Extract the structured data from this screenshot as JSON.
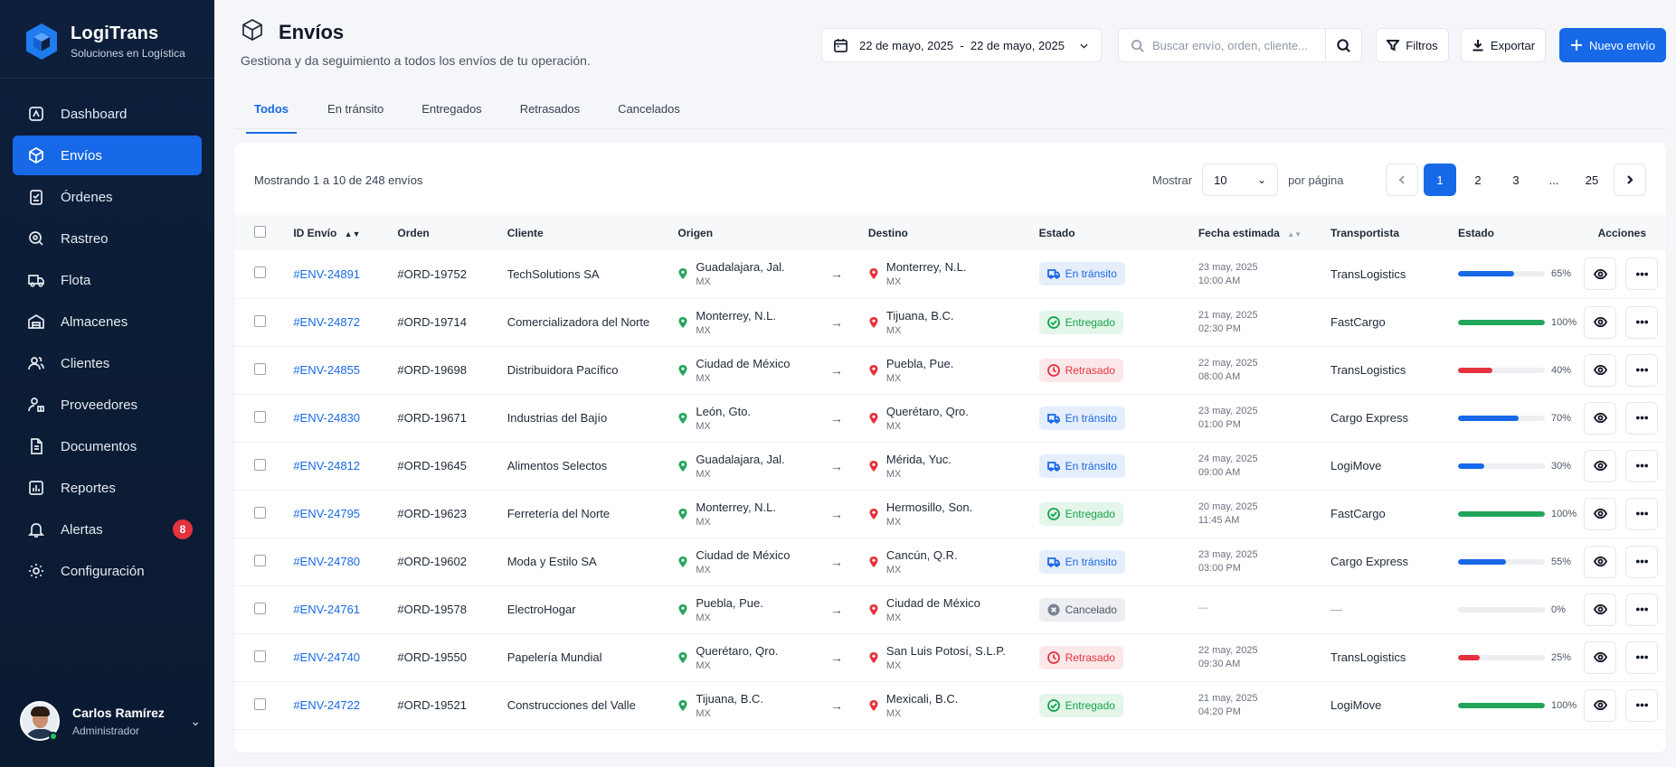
{
  "brand": {
    "name": "LogiTrans",
    "subtitle": "Soluciones en Logística"
  },
  "nav": [
    {
      "label": "Dashboard",
      "icon": "dashboard-icon",
      "active": false
    },
    {
      "label": "Envíos",
      "icon": "box-icon",
      "active": true
    },
    {
      "label": "Órdenes",
      "icon": "clipboard-icon",
      "active": false
    },
    {
      "label": "Rastreo",
      "icon": "radar-icon",
      "active": false
    },
    {
      "label": "Flota",
      "icon": "truck-icon",
      "active": false
    },
    {
      "label": "Almacenes",
      "icon": "warehouse-icon",
      "active": false
    },
    {
      "label": "Clientes",
      "icon": "users-icon",
      "active": false
    },
    {
      "label": "Proveedores",
      "icon": "supplier-icon",
      "active": false
    },
    {
      "label": "Documentos",
      "icon": "document-icon",
      "active": false
    },
    {
      "label": "Reportes",
      "icon": "report-icon",
      "active": false
    },
    {
      "label": "Alertas",
      "icon": "bell-icon",
      "active": false,
      "badge": "8"
    },
    {
      "label": "Configuración",
      "icon": "gear-icon",
      "active": false
    }
  ],
  "user": {
    "name": "Carlos Ramírez",
    "role": "Administrador"
  },
  "header": {
    "title": "Envíos",
    "subtitle": "Gestiona y da seguimiento a todos los envíos de tu operación.",
    "date_range": "22 de mayo, 2025  -  22 de mayo, 2025",
    "search_placeholder": "Buscar envío, orden, cliente...",
    "filters_label": "Filtros",
    "export_label": "Exportar",
    "new_label": "Nuevo envío"
  },
  "tabs": [
    {
      "label": "Todos",
      "active": true
    },
    {
      "label": "En tránsito",
      "active": false
    },
    {
      "label": "Entregados",
      "active": false
    },
    {
      "label": "Retrasados",
      "active": false
    },
    {
      "label": "Cancelados",
      "active": false
    }
  ],
  "table_meta": {
    "showing": "Mostrando 1 a 10 de 248 envíos",
    "show_label": "Mostrar",
    "per_page_value": "10",
    "per_page_suffix": "por página",
    "pages": [
      "1",
      "2",
      "3",
      "...",
      "25"
    ],
    "current_page": "1"
  },
  "columns": [
    "ID Envío",
    "Orden",
    "Cliente",
    "Origen",
    "Destino",
    "Estado",
    "Fecha estimada",
    "Transportista",
    "Estado",
    "Acciones"
  ],
  "colors": {
    "primary": "#1769e8",
    "transit": "#1769e8",
    "delivered": "#22a55a",
    "delayed": "#e5323e",
    "cancelled": "#6b7280"
  },
  "rows": [
    {
      "id": "#ENV-24891",
      "order": "#ORD-19752",
      "client": "TechSolutions SA",
      "origin": "Guadalajara, Jal.",
      "origin_country": "MX",
      "dest": "Monterrey, N.L.",
      "dest_country": "MX",
      "status": "En tránsito",
      "status_kind": "transit",
      "date": "23 may, 2025",
      "time": "10:00 AM",
      "carrier": "TransLogistics",
      "progress": 65,
      "progress_label": "65%"
    },
    {
      "id": "#ENV-24872",
      "order": "#ORD-19714",
      "client": "Comercializadora del Norte",
      "origin": "Monterrey, N.L.",
      "origin_country": "MX",
      "dest": "Tijuana, B.C.",
      "dest_country": "MX",
      "status": "Entregado",
      "status_kind": "delivered",
      "date": "21 may, 2025",
      "time": "02:30 PM",
      "carrier": "FastCargo",
      "progress": 100,
      "progress_label": "100%"
    },
    {
      "id": "#ENV-24855",
      "order": "#ORD-19698",
      "client": "Distribuidora Pacífico",
      "origin": "Ciudad de México",
      "origin_country": "MX",
      "dest": "Puebla, Pue.",
      "dest_country": "MX",
      "status": "Retrasado",
      "status_kind": "delayed",
      "date": "22 may, 2025",
      "time": "08:00 AM",
      "carrier": "TransLogistics",
      "progress": 40,
      "progress_label": "40%"
    },
    {
      "id": "#ENV-24830",
      "order": "#ORD-19671",
      "client": "Industrias del Bajío",
      "origin": "León, Gto.",
      "origin_country": "MX",
      "dest": "Querétaro, Qro.",
      "dest_country": "MX",
      "status": "En tránsito",
      "status_kind": "transit",
      "date": "23 may, 2025",
      "time": "01:00 PM",
      "carrier": "Cargo Express",
      "progress": 70,
      "progress_label": "70%"
    },
    {
      "id": "#ENV-24812",
      "order": "#ORD-19645",
      "client": "Alimentos Selectos",
      "origin": "Guadalajara, Jal.",
      "origin_country": "MX",
      "dest": "Mérida, Yuc.",
      "dest_country": "MX",
      "status": "En tránsito",
      "status_kind": "transit",
      "date": "24 may, 2025",
      "time": "09:00 AM",
      "carrier": "LogiMove",
      "progress": 30,
      "progress_label": "30%"
    },
    {
      "id": "#ENV-24795",
      "order": "#ORD-19623",
      "client": "Ferretería del Norte",
      "origin": "Monterrey, N.L.",
      "origin_country": "MX",
      "dest": "Hermosillo, Son.",
      "dest_country": "MX",
      "status": "Entregado",
      "status_kind": "delivered",
      "date": "20 may, 2025",
      "time": "11:45 AM",
      "carrier": "FastCargo",
      "progress": 100,
      "progress_label": "100%"
    },
    {
      "id": "#ENV-24780",
      "order": "#ORD-19602",
      "client": "Moda y Estilo SA",
      "origin": "Ciudad de México",
      "origin_country": "MX",
      "dest": "Cancún, Q.R.",
      "dest_country": "MX",
      "status": "En tránsito",
      "status_kind": "transit",
      "date": "23 may, 2025",
      "time": "03:00 PM",
      "carrier": "Cargo Express",
      "progress": 55,
      "progress_label": "55%"
    },
    {
      "id": "#ENV-24761",
      "order": "#ORD-19578",
      "client": "ElectroHogar",
      "origin": "Puebla, Pue.",
      "origin_country": "MX",
      "dest": "Ciudad de México",
      "dest_country": "MX",
      "status": "Cancelado",
      "status_kind": "cancelled",
      "date": "—",
      "time": "",
      "carrier": "—",
      "progress": 0,
      "progress_label": "0%"
    },
    {
      "id": "#ENV-24740",
      "order": "#ORD-19550",
      "client": "Papelería Mundial",
      "origin": "Querétaro, Qro.",
      "origin_country": "MX",
      "dest": "San Luis Potosí, S.L.P.",
      "dest_country": "MX",
      "status": "Retrasado",
      "status_kind": "delayed",
      "date": "22 may, 2025",
      "time": "09:30 AM",
      "carrier": "TransLogistics",
      "progress": 25,
      "progress_label": "25%"
    },
    {
      "id": "#ENV-24722",
      "order": "#ORD-19521",
      "client": "Construcciones del Valle",
      "origin": "Tijuana, B.C.",
      "origin_country": "MX",
      "dest": "Mexicali, B.C.",
      "dest_country": "MX",
      "status": "Entregado",
      "status_kind": "delivered",
      "date": "21 may, 2025",
      "time": "04:20 PM",
      "carrier": "LogiMove",
      "progress": 100,
      "progress_label": "100%"
    }
  ]
}
